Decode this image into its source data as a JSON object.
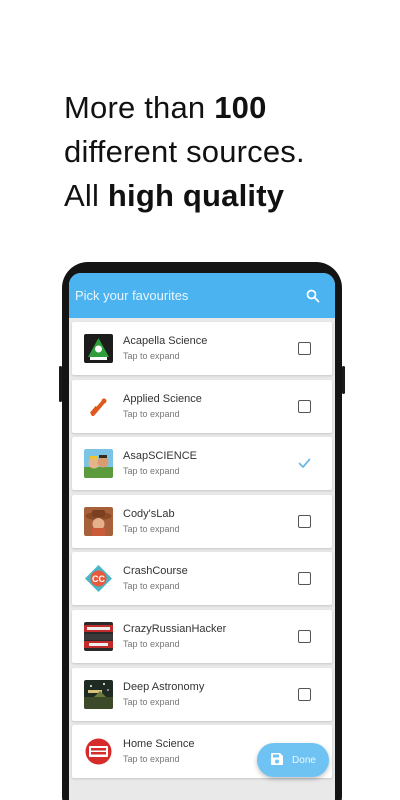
{
  "headline": {
    "line1_pre": "More than ",
    "line1_bold": "100",
    "line2": "different sources.",
    "line3_pre": "All ",
    "line3_bold": "high quality"
  },
  "app": {
    "title": "Pick your favourites",
    "accent": "#4ab3f0",
    "items": [
      {
        "name": "Acapella Science",
        "subtitle": "Tap to expand",
        "checked": false,
        "icon": "acapella-logo"
      },
      {
        "name": "Applied Science",
        "subtitle": "Tap to expand",
        "checked": false,
        "icon": "applied-science-logo"
      },
      {
        "name": "AsapSCIENCE",
        "subtitle": "Tap to expand",
        "checked": true,
        "icon": "asapscience-logo"
      },
      {
        "name": "Cody'sLab",
        "subtitle": "Tap to expand",
        "checked": false,
        "icon": "codyslab-logo"
      },
      {
        "name": "CrashCourse",
        "subtitle": "Tap to expand",
        "checked": false,
        "icon": "crashcourse-logo"
      },
      {
        "name": "CrazyRussianHacker",
        "subtitle": "Tap to expand",
        "checked": false,
        "icon": "crazyrussianhacker-logo"
      },
      {
        "name": "Deep Astronomy",
        "subtitle": "Tap to expand",
        "checked": false,
        "icon": "deep-astronomy-logo"
      },
      {
        "name": "Home Science",
        "subtitle": "Tap to expand",
        "checked": false,
        "icon": "home-science-logo"
      }
    ],
    "done_label": "Done"
  }
}
